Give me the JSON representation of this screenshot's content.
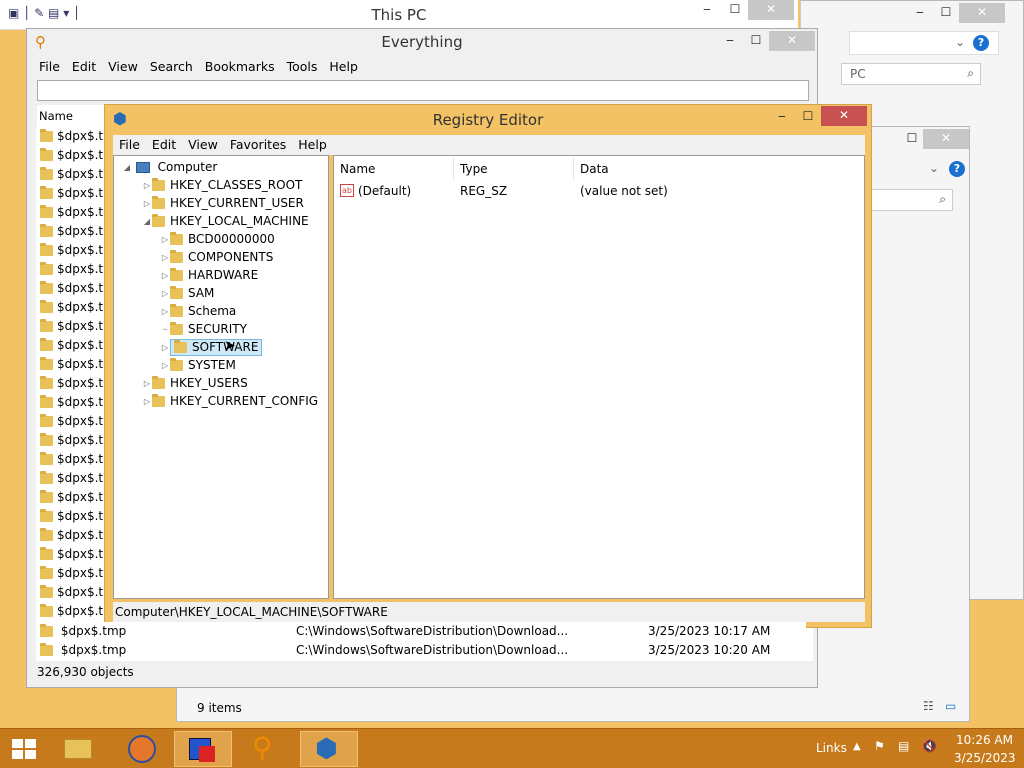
{
  "this_pc": {
    "title": "This PC",
    "search_placeholder": "PC",
    "help_icon": "?",
    "items_status": "9 items"
  },
  "everything": {
    "title": "Everything",
    "menu": [
      "File",
      "Edit",
      "View",
      "Search",
      "Bookmarks",
      "Tools",
      "Help"
    ],
    "column_name": "Name",
    "rows": [
      "$dpx$.tm",
      "$dpx$.tm",
      "$dpx$.tm",
      "$dpx$.tm",
      "$dpx$.tm",
      "$dpx$.tm",
      "$dpx$.tm",
      "$dpx$.tm",
      "$dpx$.tm",
      "$dpx$.tm",
      "$dpx$.tm",
      "$dpx$.tm",
      "$dpx$.tm",
      "$dpx$.tm",
      "$dpx$.tm",
      "$dpx$.tm",
      "$dpx$.tm",
      "$dpx$.tm",
      "$dpx$.tm",
      "$dpx$.tm",
      "$dpx$.tm",
      "$dpx$.tm",
      "$dpx$.tm",
      "$dpx$.tm",
      "$dpx$.tm",
      "$dpx$.tm",
      "$dpx$.tm"
    ],
    "bottom_rows": [
      {
        "name": "$dpx$.tmp",
        "path": "C:\\Windows\\SoftwareDistribution\\Download...",
        "date": "3/25/2023 10:17 AM"
      },
      {
        "name": "$dpx$.tmp",
        "path": "C:\\Windows\\SoftwareDistribution\\Download...",
        "date": "3/25/2023 10:20 AM"
      }
    ],
    "status": "326,930 objects"
  },
  "registry": {
    "title": "Registry Editor",
    "menu": [
      "File",
      "Edit",
      "View",
      "Favorites",
      "Help"
    ],
    "tree": {
      "root": "Computer",
      "hives": [
        "HKEY_CLASSES_ROOT",
        "HKEY_CURRENT_USER",
        "HKEY_LOCAL_MACHINE",
        "HKEY_USERS",
        "HKEY_CURRENT_CONFIG"
      ],
      "hklm_children": [
        "BCD00000000",
        "COMPONENTS",
        "HARDWARE",
        "SAM",
        "Schema",
        "SECURITY",
        "SOFTWARE",
        "SYSTEM"
      ]
    },
    "columns": {
      "name": "Name",
      "type": "Type",
      "data": "Data"
    },
    "values": [
      {
        "name": "(Default)",
        "type": "REG_SZ",
        "data": "(value not set)"
      }
    ],
    "status_path": "Computer\\HKEY_LOCAL_MACHINE\\SOFTWARE"
  },
  "taskbar": {
    "links": "Links",
    "time": "10:26 AM",
    "date": "3/25/2023"
  }
}
